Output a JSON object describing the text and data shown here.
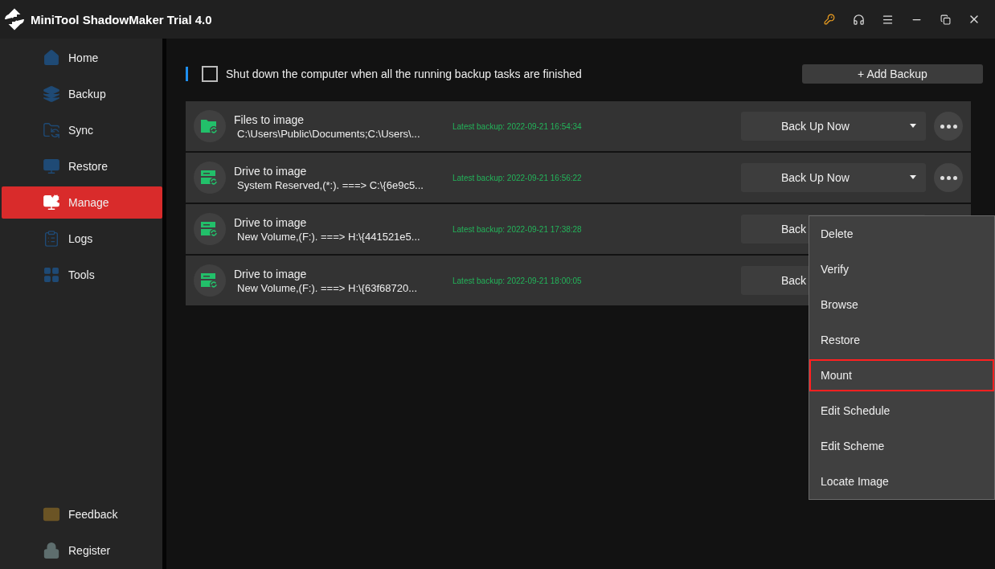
{
  "window": {
    "title": "MiniTool ShadowMaker Trial 4.0"
  },
  "sidebar": {
    "items": [
      {
        "label": "Home",
        "kind": "home",
        "selected": false
      },
      {
        "label": "Backup",
        "kind": "backup",
        "selected": false
      },
      {
        "label": "Sync",
        "kind": "sync",
        "selected": false
      },
      {
        "label": "Restore",
        "kind": "restore",
        "selected": false
      },
      {
        "label": "Manage",
        "kind": "manage",
        "selected": true
      },
      {
        "label": "Logs",
        "kind": "logs",
        "selected": false
      },
      {
        "label": "Tools",
        "kind": "tools",
        "selected": false
      }
    ],
    "footer_items": [
      {
        "label": "Feedback",
        "kind": "feedback"
      },
      {
        "label": "Register",
        "kind": "register"
      }
    ]
  },
  "toolbar": {
    "shutdown_option": {
      "label": "Shut down the computer when all the running backup tasks are finished",
      "checked": false
    },
    "add_button": "+ Add Backup"
  },
  "backups": [
    {
      "kind": "files",
      "title": "Files to image",
      "path": "C:\\Users\\Public\\Documents;C:\\Users\\...",
      "latest": "Latest backup: 2022-09-21 16:54:34",
      "button": "Back Up Now"
    },
    {
      "kind": "drive",
      "title": "Drive to image",
      "path": "System Reserved,(*:). ===> C:\\{6e9c5...",
      "latest": "Latest backup: 2022-09-21 16:56:22",
      "button": "Back Up Now"
    },
    {
      "kind": "drive",
      "title": "Drive to image",
      "path": "New Volume,(F:). ===> H:\\{441521e5...",
      "latest": "Latest backup: 2022-09-21 17:38:28",
      "button": "Back"
    },
    {
      "kind": "drive",
      "title": "Drive to image",
      "path": "New Volume,(F:). ===> H:\\{63f68720...",
      "latest": "Latest backup: 2022-09-21 18:00:05",
      "button": "Back"
    }
  ],
  "context_menu": {
    "items": [
      {
        "label": "Delete",
        "selected": false
      },
      {
        "label": "Verify",
        "selected": false
      },
      {
        "label": "Browse",
        "selected": false
      },
      {
        "label": "Restore",
        "selected": false
      },
      {
        "label": "Mount",
        "selected": true
      },
      {
        "label": "Edit Schedule",
        "selected": false
      },
      {
        "label": "Edit Scheme",
        "selected": false
      },
      {
        "label": "Locate Image",
        "selected": false
      }
    ]
  }
}
